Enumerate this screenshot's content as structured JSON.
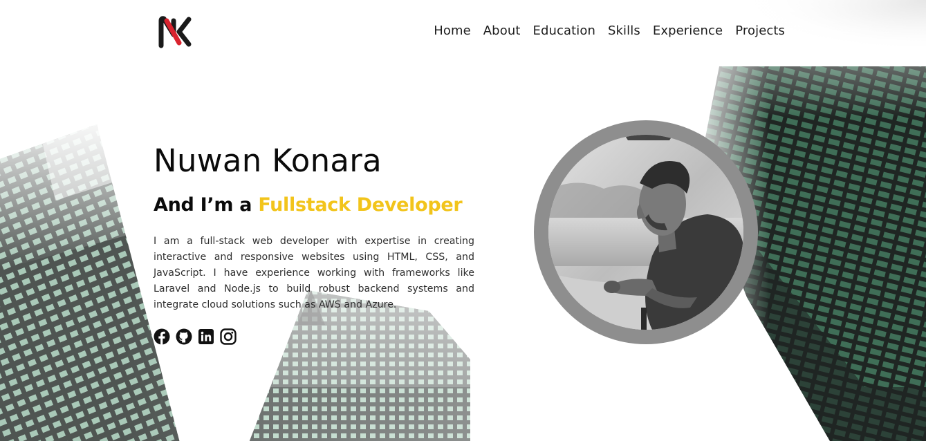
{
  "header": {
    "logo_name": "NK monogram logo",
    "nav": [
      {
        "label": "Home"
      },
      {
        "label": "About"
      },
      {
        "label": "Education"
      },
      {
        "label": "Skills"
      },
      {
        "label": "Experience"
      },
      {
        "label": "Projects"
      }
    ]
  },
  "hero": {
    "name": "Nuwan Konara",
    "role_prefix": "And I’m a",
    "role_highlight": "Fullstack Developer",
    "description": "I am a full-stack web developer with expertise in creating interactive and responsive websites using HTML, CSS, and JavaScript. I have experience working with frameworks like Laravel and Node.js to build robust backend systems and integrate cloud solutions such as AWS and Azure.",
    "socials": [
      {
        "icon": "facebook-icon"
      },
      {
        "icon": "github-icon"
      },
      {
        "icon": "linkedin-icon"
      },
      {
        "icon": "instagram-icon"
      }
    ]
  },
  "colors": {
    "accent": "#f2c41b",
    "text": "#0b0b0b",
    "ring": "#8e8e8e"
  }
}
